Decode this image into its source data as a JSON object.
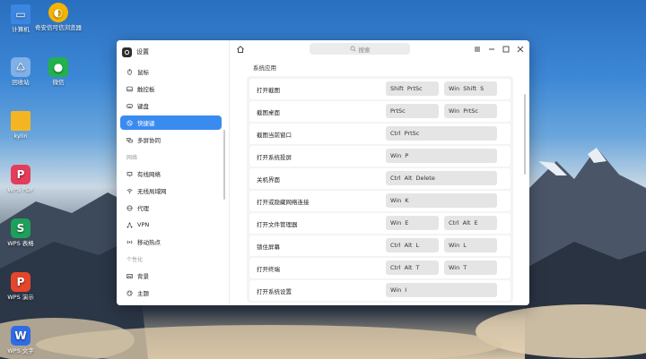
{
  "desktop": {
    "icons": [
      {
        "label": "计算机",
        "icon": "computer-icon",
        "color": "#3b86e0"
      },
      {
        "label": "奇安信可信浏览器",
        "icon": "browser-icon",
        "color": "#f4b400"
      },
      {
        "label": "回收站",
        "icon": "trash-icon",
        "color": "#7fb0e6"
      },
      {
        "label": "微信",
        "icon": "wechat-icon",
        "color": "#22b14c"
      },
      {
        "label": "kylin",
        "icon": "folder-icon",
        "color": "#f5b523"
      },
      {
        "label": "WPS PDF",
        "icon": "wps-pdf-icon",
        "color": "#e43d5a"
      },
      {
        "label": "WPS 表格",
        "icon": "wps-sheet-icon",
        "color": "#1e9f5a"
      },
      {
        "label": "WPS 演示",
        "icon": "wps-slides-icon",
        "color": "#e4462c"
      },
      {
        "label": "WPS 文字",
        "icon": "wps-writer-icon",
        "color": "#2f6ce5"
      }
    ]
  },
  "window": {
    "app_title": "设置",
    "search_placeholder": "搜索"
  },
  "sidebar": {
    "items": [
      {
        "label": "鼠标",
        "icon": "mouse-icon"
      },
      {
        "label": "触控板",
        "icon": "touchpad-icon"
      },
      {
        "label": "键盘",
        "icon": "keyboard-icon"
      },
      {
        "label": "快捷键",
        "icon": "shortcut-icon",
        "active": true
      },
      {
        "label": "多屏协同",
        "icon": "multiscreen-icon"
      }
    ],
    "section_network": "网络",
    "network_items": [
      {
        "label": "有线网络",
        "icon": "wired-network-icon"
      },
      {
        "label": "无线局域网",
        "icon": "wifi-icon"
      },
      {
        "label": "代理",
        "icon": "proxy-icon"
      },
      {
        "label": "VPN",
        "icon": "vpn-icon"
      },
      {
        "label": "移动热点",
        "icon": "hotspot-icon"
      }
    ],
    "section_personalize": "个性化",
    "personalize_items": [
      {
        "label": "背景",
        "icon": "background-icon"
      },
      {
        "label": "主题",
        "icon": "theme-icon"
      }
    ]
  },
  "shortcuts": {
    "section_title": "系统应用",
    "rows": [
      {
        "label": "打开截图",
        "keys": [
          "Shift  PrtSc",
          "Win  Shift  S"
        ]
      },
      {
        "label": "截图桌面",
        "keys": [
          "PrtSc",
          "Win  PrtSc"
        ]
      },
      {
        "label": "截图当前窗口",
        "keys": [
          "Ctrl  PrtSc"
        ]
      },
      {
        "label": "打开系统投屏",
        "keys": [
          "Win  P"
        ]
      },
      {
        "label": "关机界面",
        "keys": [
          "Ctrl  Alt  Delete"
        ]
      },
      {
        "label": "打开或隐藏网络连接",
        "keys": [
          "Win  K"
        ]
      },
      {
        "label": "打开文件管理器",
        "keys": [
          "Win  E",
          "Ctrl  Alt  E"
        ]
      },
      {
        "label": "锁住屏幕",
        "keys": [
          "Ctrl  Alt  L",
          "Win  L"
        ]
      },
      {
        "label": "打开终端",
        "keys": [
          "Ctrl  Alt  T",
          "Win  T"
        ]
      },
      {
        "label": "打开系统设置",
        "keys": [
          "Win  I"
        ]
      }
    ]
  }
}
